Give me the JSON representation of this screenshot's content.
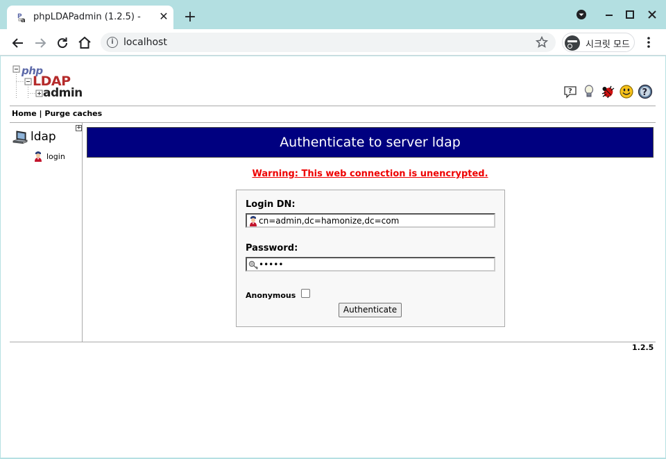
{
  "browser": {
    "tab_title": "phpLDAPadmin (1.2.5) -",
    "tab_close": "✕",
    "new_tab": "+",
    "url": "localhost",
    "incognito_label": "시크릿 모드"
  },
  "app": {
    "logo": {
      "php": "php",
      "ldap": "LDAP",
      "admin": "admin"
    },
    "header_icons": [
      "help-icon",
      "tips-icon",
      "bug-icon",
      "donate-icon",
      "about-icon"
    ],
    "breadcrumb": {
      "home": "Home",
      "sep": "|",
      "purge": "Purge caches"
    },
    "tree": {
      "server_name": "ldap",
      "login_label": "login",
      "expander": "+"
    },
    "footer_version": "1.2.5"
  },
  "login": {
    "banner": "Authenticate to server ldap",
    "warning": "Warning: This web connection is unencrypted.",
    "dn_label": "Login DN:",
    "dn_value": "cn=admin,dc=hamonize,dc=com",
    "password_label": "Password:",
    "password_value": "•••••",
    "anonymous_label": "Anonymous",
    "anonymous_checked": false,
    "submit_label": "Authenticate"
  },
  "colors": {
    "banner_bg": "#000080",
    "warning_text": "#e00000",
    "browser_frame": "#b3dfe1"
  }
}
